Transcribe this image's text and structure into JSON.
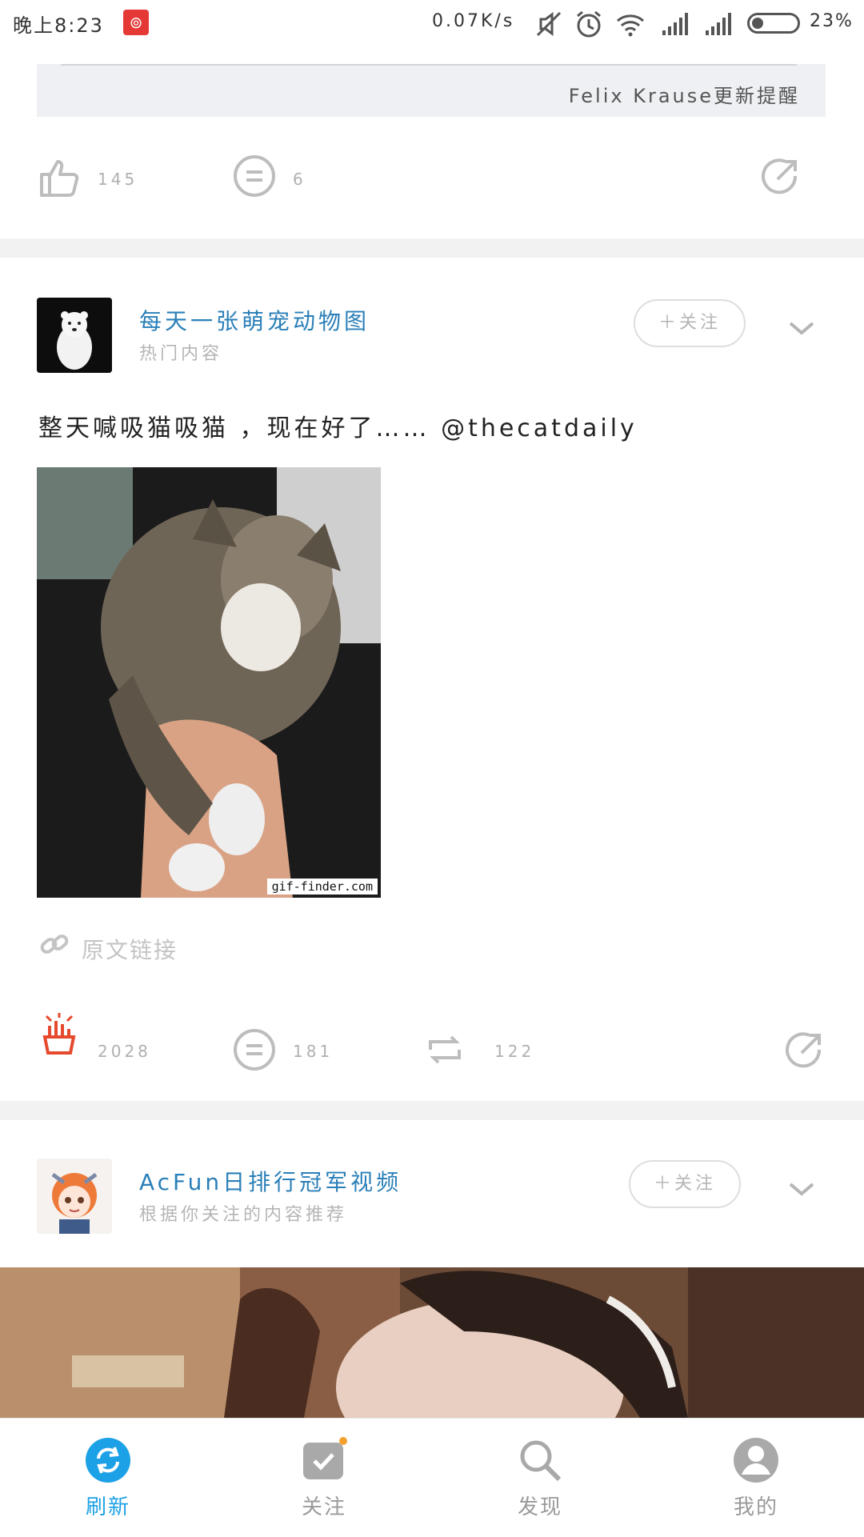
{
  "status_bar": {
    "time": "晚上8:23",
    "net_speed": "0.07K/s",
    "battery_pct": "23%",
    "icons": [
      "app-notification-icon",
      "mute-icon",
      "alarm-icon",
      "wifi-icon",
      "signal-icon",
      "signal-icon",
      "battery-icon"
    ]
  },
  "prev_card": {
    "quote_text": "Felix Krause更新提醒",
    "like_count": "145",
    "comment_count": "6"
  },
  "card1": {
    "source_name": "每天一张萌宠动物图",
    "source_sub": "热门内容",
    "follow_label": "＋关注",
    "title": "整天喊吸猫吸猫 ，现在好了…… @thecatdaily",
    "image_watermark": "gif-finder.com",
    "link_label": "原文链接",
    "like_count": "2028",
    "comment_count": "181",
    "repost_count": "122"
  },
  "card2": {
    "source_name": "AcFun日排行冠军视频",
    "source_sub": "根据你关注的内容推荐",
    "follow_label": "＋关注"
  },
  "tabbar": {
    "tabs": [
      {
        "label": "刷新",
        "icon": "refresh-icon",
        "active": true
      },
      {
        "label": "关注",
        "icon": "check-box-icon",
        "active": false
      },
      {
        "label": "发现",
        "icon": "search-icon",
        "active": false
      },
      {
        "label": "我的",
        "icon": "profile-icon",
        "active": false
      }
    ]
  },
  "colors": {
    "accent": "#1da1e6",
    "source_link": "#2a7fb8",
    "liked_red": "#e64a2e",
    "muted_gray": "#bdbdbd"
  }
}
